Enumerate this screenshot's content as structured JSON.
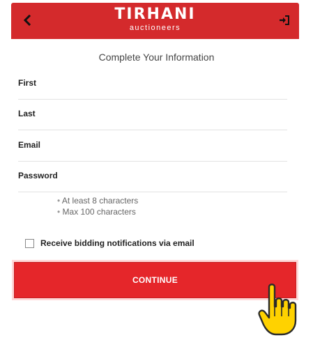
{
  "header": {
    "brand_name": "TIRHANI",
    "brand_tagline": "auctioneers",
    "back_icon": "chevron-left-icon",
    "signin_icon": "sign-in-icon",
    "background_color": "#d42a2c"
  },
  "form": {
    "title": "Complete Your Information",
    "fields": [
      {
        "label": "First",
        "value": ""
      },
      {
        "label": "Last",
        "value": ""
      },
      {
        "label": "Email",
        "value": ""
      },
      {
        "label": "Password",
        "value": ""
      }
    ],
    "password_rules": [
      "At least 8 characters",
      "Max 100 characters"
    ],
    "notifications_label": "Receive bidding notifications via email",
    "notifications_checked": false,
    "continue_label": "CONTINUE",
    "button_color": "#e5262a"
  },
  "cursor": {
    "icon": "hand-pointer-icon",
    "color": "#ffd200"
  }
}
